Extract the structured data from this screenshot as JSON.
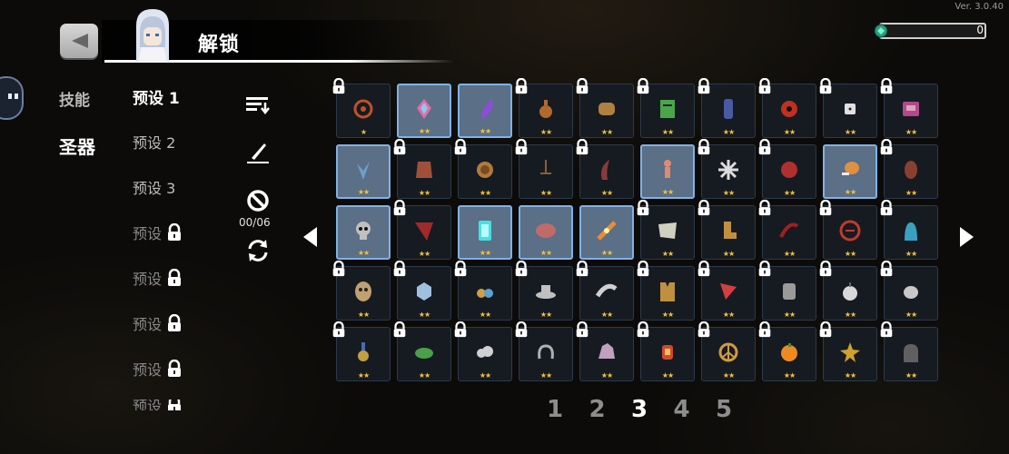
{
  "header": {
    "title": "解锁",
    "version": "Ver. 3.0.40",
    "gem_count": "0",
    "gem_color": "#3cc7a0"
  },
  "categories": [
    {
      "label": "技能",
      "active": false
    },
    {
      "label": "圣器",
      "active": true
    }
  ],
  "presets": [
    {
      "label": "预设 1",
      "state": "active"
    },
    {
      "label": "预设 2",
      "state": "normal"
    },
    {
      "label": "预设 3",
      "state": "normal"
    },
    {
      "label": "预设",
      "state": "locked"
    },
    {
      "label": "预设",
      "state": "locked"
    },
    {
      "label": "预设",
      "state": "locked"
    },
    {
      "label": "预设",
      "state": "locked"
    },
    {
      "label": "预设",
      "state": "locked"
    }
  ],
  "tools": {
    "sort_icon": "sort-icon",
    "edit_icon": "pen-icon",
    "clear_icon": "prohibit-icon",
    "equipped_count": "00/06",
    "refresh_icon": "refresh-icon"
  },
  "accent": "#f3c13a",
  "grid": {
    "rows": [
      [
        {
          "icon": "swirl-icon",
          "color": "#c0502a",
          "stars": "★",
          "locked": true
        },
        {
          "icon": "crystal-icon",
          "color": "#e66aa8",
          "stars": "★★",
          "locked": false
        },
        {
          "icon": "feather-icon",
          "color": "#8a4fd6",
          "stars": "★★",
          "locked": false
        },
        {
          "icon": "potion-icon",
          "color": "#b06a2e",
          "stars": "★★",
          "locked": true
        },
        {
          "icon": "fist-icon",
          "color": "#b08040",
          "stars": "★★",
          "locked": true
        },
        {
          "icon": "scroll-icon",
          "color": "#4aa64a",
          "stars": "★★",
          "locked": true
        },
        {
          "icon": "totem-icon",
          "color": "#4a5aa0",
          "stars": "★★",
          "locked": true
        },
        {
          "icon": "eye-icon",
          "color": "#c03020",
          "stars": "★★",
          "locked": true
        },
        {
          "icon": "dice-icon",
          "color": "#e0e0e0",
          "stars": "★★",
          "locked": true
        },
        {
          "icon": "book-icon",
          "color": "#b04a8a",
          "stars": "★★",
          "locked": true
        }
      ],
      [
        {
          "icon": "leaf-icon",
          "color": "#6aa0d0",
          "stars": "★★",
          "locked": false
        },
        {
          "icon": "cloak-icon",
          "color": "#a0503a",
          "stars": "★★",
          "locked": true
        },
        {
          "icon": "coin-icon",
          "color": "#b07a3a",
          "stars": "★★",
          "locked": true
        },
        {
          "icon": "sword-icon",
          "color": "#8a6030",
          "stars": "★★",
          "locked": true
        },
        {
          "icon": "horn-icon",
          "color": "#8a3a3a",
          "stars": "★★",
          "locked": true
        },
        {
          "icon": "figure-icon",
          "color": "#e08a70",
          "stars": "★★",
          "locked": false
        },
        {
          "icon": "snowflake-icon",
          "color": "#dcdcdc",
          "stars": "★★",
          "locked": true
        },
        {
          "icon": "orb-icon",
          "color": "#b03030",
          "stars": "★★",
          "locked": true
        },
        {
          "icon": "drumstick-icon",
          "color": "#e09040",
          "stars": "★★",
          "locked": false
        },
        {
          "icon": "seed-icon",
          "color": "#8a4030",
          "stars": "★★",
          "locked": true
        }
      ],
      [
        {
          "icon": "skull-icon",
          "color": "#c0c0c0",
          "stars": "★★",
          "locked": false
        },
        {
          "icon": "cape-icon",
          "color": "#a02a2a",
          "stars": "★★",
          "locked": true
        },
        {
          "icon": "gem-icon",
          "color": "#48e0e0",
          "stars": "★★",
          "locked": false
        },
        {
          "icon": "meat-icon",
          "color": "#c06a6a",
          "stars": "★★",
          "locked": false
        },
        {
          "icon": "wand-icon",
          "color": "#f08a30",
          "stars": "★★",
          "locked": false
        },
        {
          "icon": "map-icon",
          "color": "#d0d0c0",
          "stars": "★★",
          "locked": true
        },
        {
          "icon": "boot-icon",
          "color": "#c09040",
          "stars": "★★",
          "locked": true
        },
        {
          "icon": "claw-icon",
          "color": "#a02020",
          "stars": "★★",
          "locked": true
        },
        {
          "icon": "rune-icon",
          "color": "#c03a2a",
          "stars": "★★",
          "locked": true
        },
        {
          "icon": "spirit-icon",
          "color": "#3aa0c0",
          "stars": "★★",
          "locked": true
        }
      ],
      [
        {
          "icon": "mask-icon",
          "color": "#c0a070",
          "stars": "★★",
          "locked": true
        },
        {
          "icon": "ice-icon",
          "color": "#a0c0e0",
          "stars": "★★",
          "locked": true
        },
        {
          "icon": "berries-icon",
          "color": "#d0a040",
          "stars": "★★",
          "locked": true
        },
        {
          "icon": "hat-icon",
          "color": "#c0c0c0",
          "stars": "★★",
          "locked": true
        },
        {
          "icon": "tail-icon",
          "color": "#d0d0d0",
          "stars": "★★",
          "locked": true
        },
        {
          "icon": "vest-icon",
          "color": "#c09040",
          "stars": "★★",
          "locked": true
        },
        {
          "icon": "banner-icon",
          "color": "#d04040",
          "stars": "★★",
          "locked": true
        },
        {
          "icon": "gauntlet-icon",
          "color": "#9a9a9a",
          "stars": "★★",
          "locked": true
        },
        {
          "icon": "apple-icon",
          "color": "#d8d8d8",
          "stars": "★★",
          "locked": true
        },
        {
          "icon": "stone-icon",
          "color": "#c8c8c8",
          "stars": "★★",
          "locked": true
        }
      ],
      [
        {
          "icon": "medal-icon",
          "color": "#c0a040",
          "stars": "★★",
          "locked": true
        },
        {
          "icon": "bird-icon",
          "color": "#4aa04a",
          "stars": "★★",
          "locked": true
        },
        {
          "icon": "cloud-icon",
          "color": "#d0d0d0",
          "stars": "★★",
          "locked": true
        },
        {
          "icon": "chain-icon",
          "color": "#b0b0b0",
          "stars": "★★",
          "locked": true
        },
        {
          "icon": "ore-icon",
          "color": "#c0a0c0",
          "stars": "★★",
          "locked": true
        },
        {
          "icon": "lantern-icon",
          "color": "#d04a30",
          "stars": "★★",
          "locked": true
        },
        {
          "icon": "peace-icon",
          "color": "#d09a40",
          "stars": "★★",
          "locked": true
        },
        {
          "icon": "orange-icon",
          "color": "#f08a20",
          "stars": "★★",
          "locked": true
        },
        {
          "icon": "star-shard-icon",
          "color": "#d0a030",
          "stars": "★★",
          "locked": true
        },
        {
          "icon": "ghost-icon",
          "color": "#606060",
          "stars": "★★",
          "locked": true
        }
      ]
    ]
  },
  "pagination": {
    "pages": [
      "1",
      "2",
      "3",
      "4",
      "5"
    ],
    "current": "3"
  }
}
